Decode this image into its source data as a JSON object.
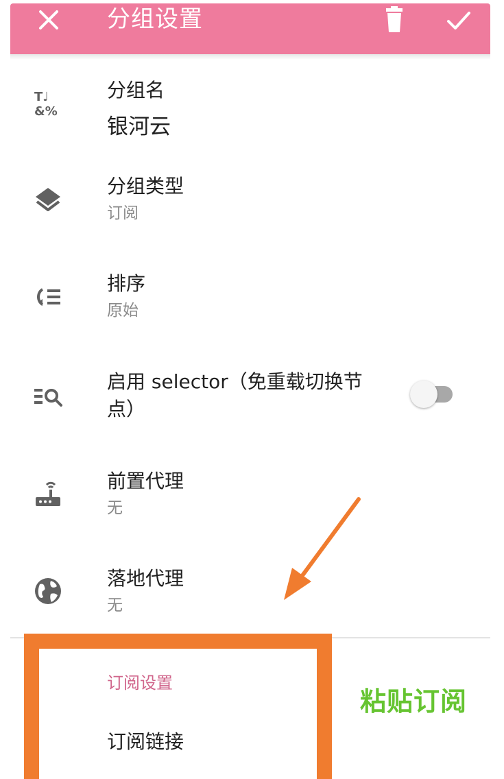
{
  "appbar": {
    "title": "分组设置",
    "icons": [
      "close-icon",
      "delete-icon",
      "check-icon"
    ]
  },
  "settings": [
    {
      "title": "分组名",
      "value": "银河云",
      "icon": "text-format-icon"
    },
    {
      "title": "分组类型",
      "subtitle": "订阅",
      "icon": "layers-icon"
    },
    {
      "title": "排序",
      "subtitle": "原始",
      "icon": "sort-icon"
    },
    {
      "title": "启用 selector（免重载切换节",
      "title_line2": "点）",
      "icon": "filter-search-icon",
      "toggle_on": false
    },
    {
      "title": "前置代理",
      "subtitle": "无",
      "icon": "router-icon"
    },
    {
      "title": "落地代理",
      "subtitle": "无",
      "icon": "globe-icon"
    }
  ],
  "subscription_section": {
    "header": "订阅设置",
    "link_title": "订阅链接"
  },
  "annotation": {
    "label": "粘贴订阅",
    "label_color": "#66c431",
    "box_color": "#f07c2f",
    "arrow_color": "#f07c2f"
  },
  "colors": {
    "appbar": "#ef7b9d",
    "section_header": "#d0658b"
  }
}
